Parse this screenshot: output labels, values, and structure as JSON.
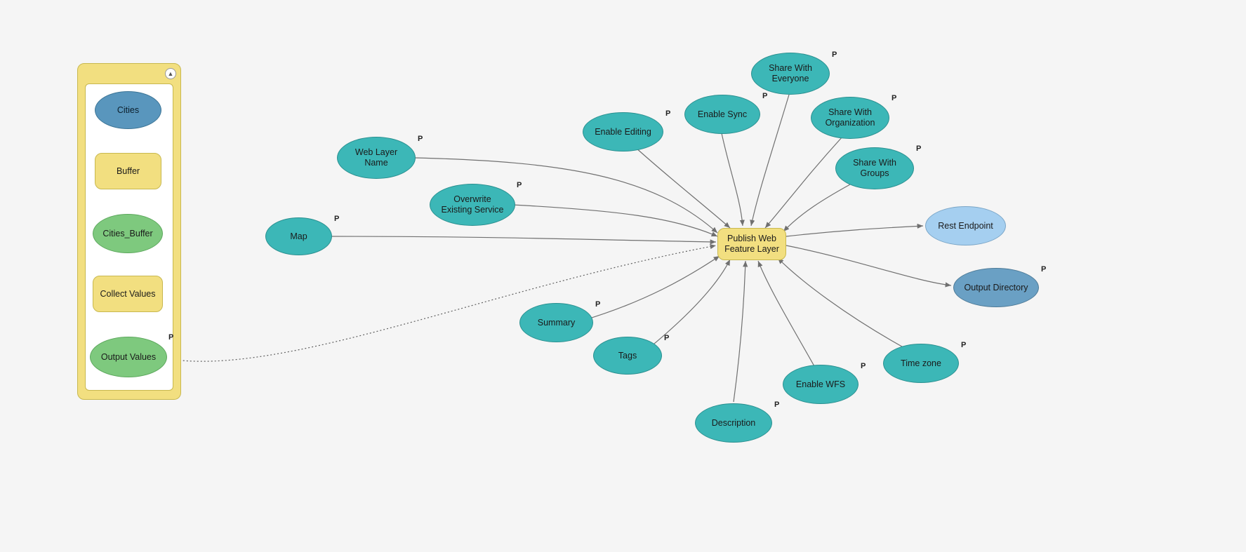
{
  "group": {
    "collapse_glyph": "▲"
  },
  "sub": {
    "cities": "Cities",
    "buffer": "Buffer",
    "cities_buffer": "Cities_Buffer",
    "collect_values": "Collect Values",
    "output_values": "Output Values"
  },
  "params": {
    "map": "Map",
    "web_layer_name": "Web Layer\nName",
    "overwrite": "Overwrite\nExisting Service",
    "enable_editing": "Enable Editing",
    "enable_sync": "Enable Sync",
    "share_everyone": "Share With\nEveryone",
    "share_org": "Share With\nOrganization",
    "share_groups": "Share With\nGroups",
    "summary": "Summary",
    "tags": "Tags",
    "description": "Description",
    "enable_wfs": "Enable WFS",
    "time_zone": "Time zone",
    "rest_endpoint": "Rest Endpoint",
    "output_dir": "Output Directory"
  },
  "tool": {
    "publish": "Publish Web\nFeature Layer"
  },
  "badge": "P"
}
